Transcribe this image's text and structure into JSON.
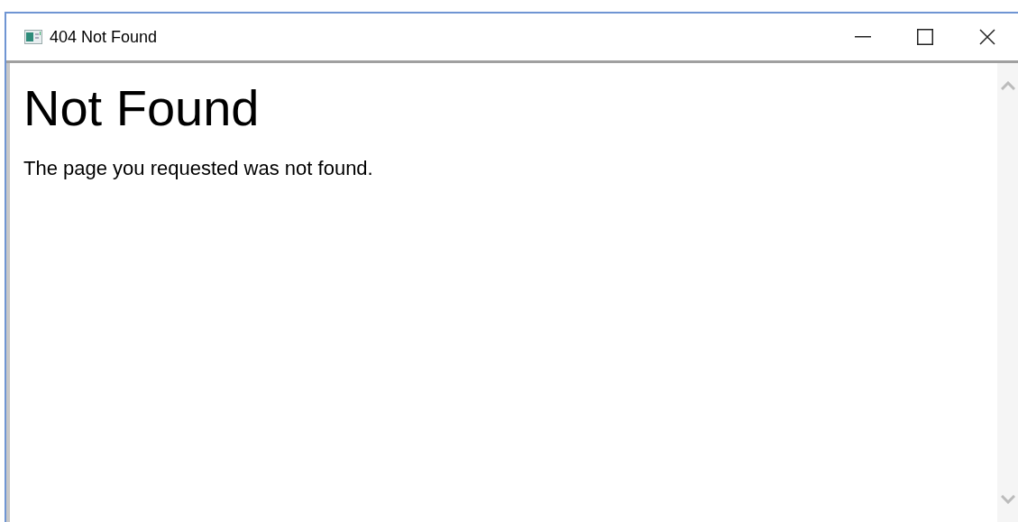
{
  "window": {
    "title": "404 Not Found"
  },
  "page": {
    "heading": "Not Found",
    "message": "The page you requested was not found."
  }
}
